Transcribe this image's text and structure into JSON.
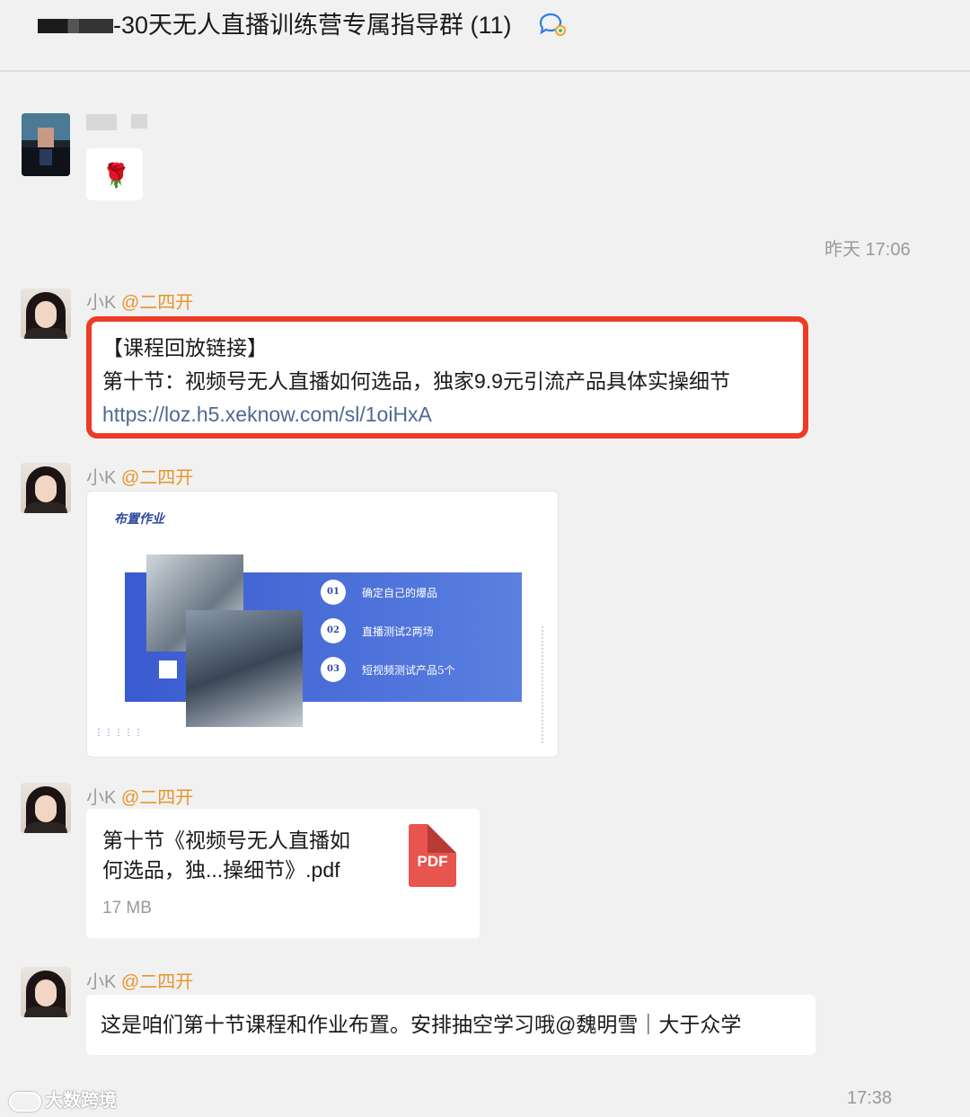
{
  "header": {
    "title": "-30天无人直播训练营专属指导群 (11)",
    "icon": "group-chat-icon"
  },
  "messages": {
    "m1": {
      "emoji": "🌹"
    },
    "ts1": "昨天 17:06",
    "m2": {
      "sender": "小K",
      "tag": "@二四开",
      "line1": "【课程回放链接】",
      "line2": "第十节：视频号无人直播如何选品，独家9.9元引流产品具体实操细节",
      "url": "https://loz.h5.xeknow.com/sl/1oiHxA"
    },
    "m3": {
      "sender": "小K",
      "tag": "@二四开",
      "slide": {
        "title": "布置作业",
        "items": [
          {
            "num": "01",
            "text": "确定自己的爆品"
          },
          {
            "num": "02",
            "text": "直播测试2两场"
          },
          {
            "num": "03",
            "text": "短视频测试产品5个"
          }
        ]
      }
    },
    "m4": {
      "sender": "小K",
      "tag": "@二四开",
      "file_line1": "第十节《视频号无人直播如",
      "file_line2": "何选品，独...操细节》.pdf",
      "file_size": "17 MB",
      "file_type": "PDF"
    },
    "m5": {
      "sender": "小K",
      "tag": "@二四开",
      "text": "这是咱们第十节课程和作业布置。安排抽空学习哦@魏明雪｜大于众学"
    },
    "ts2": "17:38"
  },
  "watermark": "大数跨境",
  "colors": {
    "background": "#f1f1f1",
    "highlight_border": "#ee3b24",
    "sender_tag": "#e8952a",
    "link": "#4e6a92",
    "pdf": "#e8554e"
  }
}
